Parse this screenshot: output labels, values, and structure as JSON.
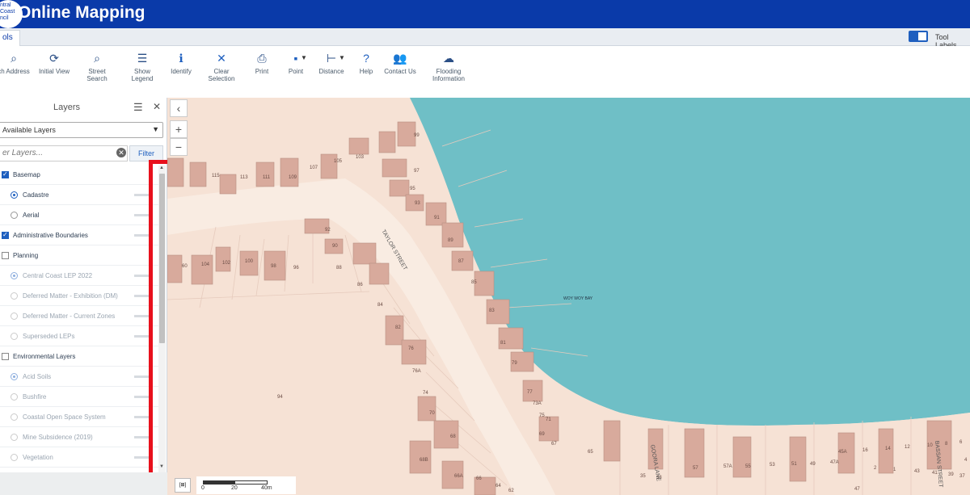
{
  "header": {
    "title": "Online Mapping",
    "logo_text": "ntral Coast ncil"
  },
  "tabs": {
    "active": "ols",
    "tool_labels": "Tool Labels"
  },
  "toolbar": [
    {
      "label": "ch Address",
      "icon": "search-address-icon",
      "glyph": "⌕"
    },
    {
      "label": "Initial View",
      "icon": "initial-view-icon",
      "glyph": "⟳"
    },
    {
      "label": "Street Search",
      "icon": "street-search-icon",
      "glyph": "⌕"
    },
    {
      "label": "Show Legend",
      "icon": "legend-icon",
      "glyph": "☰"
    },
    {
      "label": "Identify",
      "icon": "identify-icon",
      "glyph": "ℹ"
    },
    {
      "label": "Clear Selection",
      "icon": "clear-selection-icon",
      "glyph": "✕"
    },
    {
      "label": "Print",
      "icon": "print-icon",
      "glyph": "⎙"
    },
    {
      "label": "Point",
      "icon": "point-icon",
      "glyph": "▪"
    },
    {
      "label": "Distance",
      "icon": "distance-icon",
      "glyph": "⊢"
    },
    {
      "label": "Help",
      "icon": "help-icon",
      "glyph": "?"
    },
    {
      "label": "Contact Us",
      "icon": "contact-us-icon",
      "glyph": "👥"
    },
    {
      "label": "Flooding",
      "label2": "Information",
      "icon": "flooding-icon",
      "glyph": "☁"
    }
  ],
  "panel": {
    "title": "Layers",
    "select_value": "Available Layers",
    "filter_placeholder": "er Layers...",
    "filter_button": "Filter",
    "layers": [
      {
        "label": "Basemap",
        "kind": "group",
        "checked": true
      },
      {
        "label": "Cadastre",
        "kind": "radio",
        "checked": true
      },
      {
        "label": "Aerial",
        "kind": "radio",
        "checked": false
      },
      {
        "label": "Administrative Boundaries",
        "kind": "group",
        "checked": true
      },
      {
        "label": "Planning",
        "kind": "group",
        "checked": false
      },
      {
        "label": "Central Coast LEP 2022",
        "kind": "radio",
        "checked": true,
        "dim": true
      },
      {
        "label": "Deferred Matter - Exhibition (DM)",
        "kind": "radio",
        "checked": false,
        "dim": true
      },
      {
        "label": "Deferred Matter - Current Zones",
        "kind": "radio",
        "checked": false,
        "dim": true
      },
      {
        "label": "Superseded LEPs",
        "kind": "radio",
        "checked": false,
        "dim": true
      },
      {
        "label": "Environmental Layers",
        "kind": "group",
        "checked": false
      },
      {
        "label": "Acid Soils",
        "kind": "radio",
        "checked": true,
        "dim": true
      },
      {
        "label": "Bushfire",
        "kind": "radio",
        "checked": false,
        "dim": true
      },
      {
        "label": "Coastal Open Space System",
        "kind": "radio",
        "checked": false,
        "dim": true
      },
      {
        "label": "Mine Subsidence (2019)",
        "kind": "radio",
        "checked": false,
        "dim": true
      },
      {
        "label": "Vegetation",
        "kind": "radio",
        "checked": false,
        "dim": true
      }
    ]
  },
  "map": {
    "water_label": "WOY WOY BAY",
    "streets": [
      "TAYLOR STREET",
      "GOORA LANE",
      "BASSAN STREET"
    ],
    "lot_numbers": [
      "99",
      "97",
      "95",
      "93",
      "91",
      "89",
      "87",
      "85",
      "83",
      "81",
      "79",
      "77",
      "75",
      "73A",
      "71",
      "69",
      "67",
      "65",
      "107",
      "105",
      "103",
      "109",
      "111",
      "113",
      "115",
      "92",
      "90",
      "88",
      "86",
      "84",
      "82",
      "76",
      "76A",
      "74",
      "70",
      "68",
      "68B",
      "66A",
      "66",
      "64",
      "62",
      "60",
      "104",
      "102",
      "100",
      "98",
      "96",
      "94",
      "57",
      "57A",
      "55",
      "53",
      "51",
      "49",
      "47A",
      "47",
      "45A",
      "16",
      "14",
      "12",
      "10",
      "8",
      "6",
      "4",
      "2",
      "1",
      "43",
      "41",
      "39",
      "37",
      "35",
      "33"
    ],
    "scale_labels": [
      "0",
      "20",
      "40m"
    ],
    "colors": {
      "water": "#6fbfc6",
      "land": "#f6e2d5",
      "building": "#d8aa9c",
      "road": "#f9ece2"
    }
  }
}
